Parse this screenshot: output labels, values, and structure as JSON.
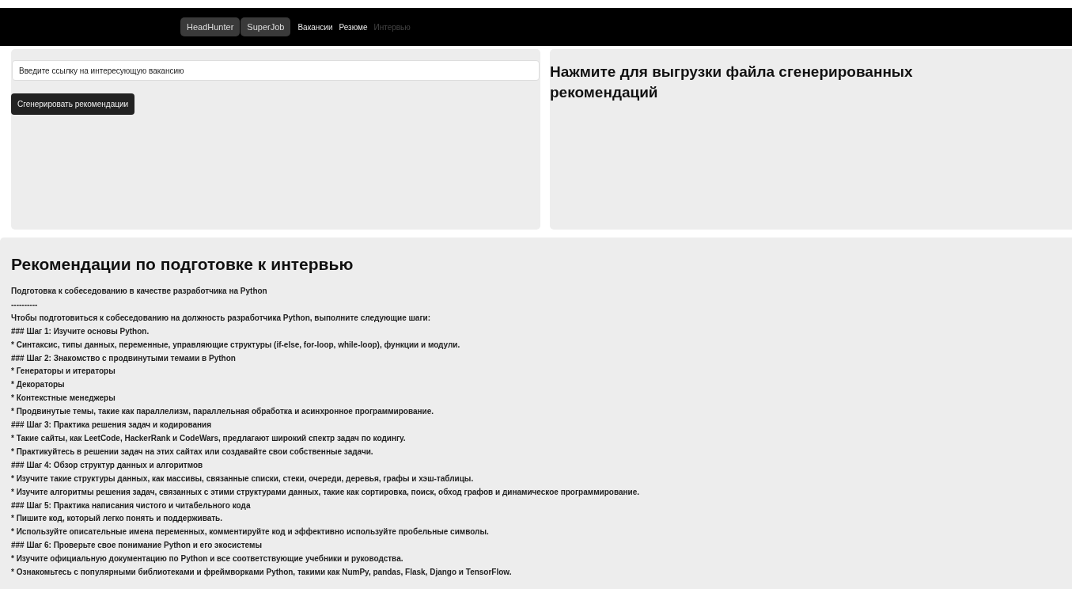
{
  "nav": {
    "sources": [
      {
        "label": "HeadHunter",
        "selected": true
      },
      {
        "label": "SuperJob",
        "selected": true
      }
    ],
    "links": [
      {
        "label": "Вакансии",
        "disabled": false
      },
      {
        "label": "Резюме",
        "disabled": false
      },
      {
        "label": "Интервью",
        "disabled": true
      }
    ]
  },
  "form": {
    "placeholder": "Введите ссылку на интересующую вакансию",
    "button": "Сгенерировать рекомендации"
  },
  "download": {
    "title": "Нажмите для выгрузки файла сгенерированных рекомендаций"
  },
  "recommendations": {
    "title": "Рекомендации по подготовке к интервью",
    "lines": [
      "Подготовка к собеседованию в качестве разработчика на Python",
      "----------",
      "Чтобы подготовиться к собеседованию на должность разработчика Python, выполните следующие шаги:",
      "### Шаг 1: Изучите основы Python.",
      "* Синтаксис, типы данных, переменные, управляющие структуры (if-else, for-loop, while-loop), функции и модули.",
      "### Шаг 2: Знакомство с продвинутыми темами в Python",
      "* Генераторы и итераторы",
      "* Декораторы",
      "* Контекстные менеджеры",
      "* Продвинутые темы, такие как параллелизм, параллельная обработка и асинхронное программирование.",
      "### Шаг 3: Практика решения задач и кодирования",
      "* Такие сайты, как LeetCode, HackerRank и CodeWars, предлагают широкий спектр задач по кодингу.",
      "* Практикуйтесь в решении задач на этих сайтах или создавайте свои собственные задачи.",
      "### Шаг 4: Обзор структур данных и алгоритмов",
      "* Изучите такие структуры данных, как массивы, связанные списки, стеки, очереди, деревья, графы и хэш-таблицы.",
      "* Изучите алгоритмы решения задач, связанных с этими структурами данных, такие как сортировка, поиск, обход графов и динамическое программирование.",
      "### Шаг 5: Практика написания чистого и читабельного кода",
      "* Пишите код, который легко понять и поддерживать.",
      "* Используйте описательные имена переменных, комментируйте код и эффективно используйте пробельные символы.",
      "### Шаг 6: Проверьте свое понимание Python и его экосистемы",
      "* Изучите официальную документацию по Python и все соответствующие учебники и руководства.",
      "* Ознакомьтесь с популярными библиотеками и фреймворками Python, такими как NumPy, pandas, Flask, Django и TensorFlow."
    ]
  }
}
